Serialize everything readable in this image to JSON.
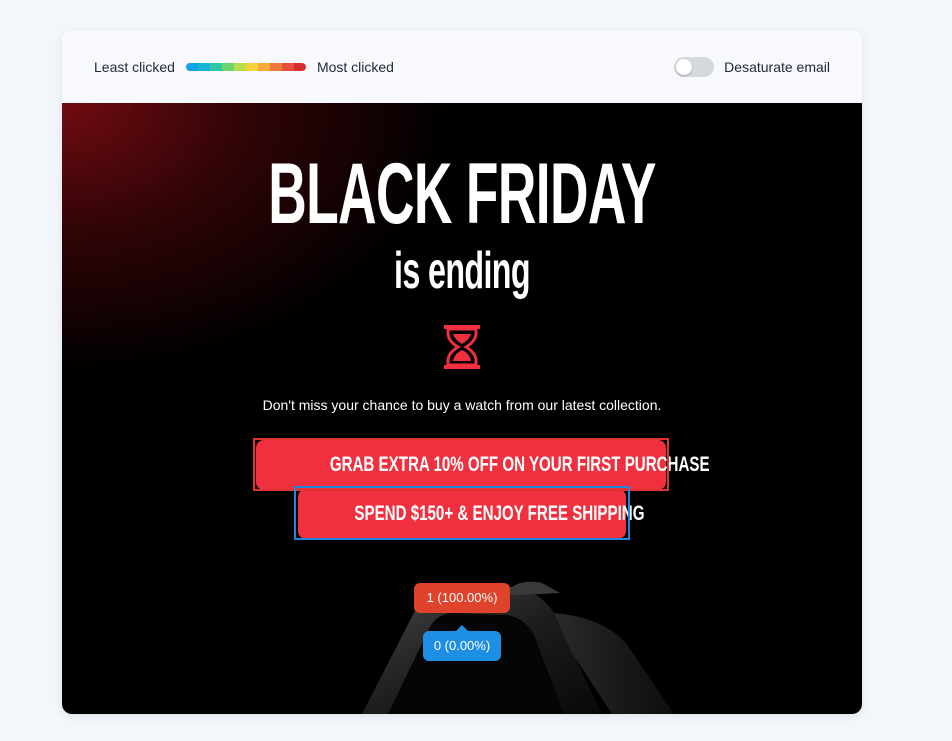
{
  "legend": {
    "least_label": "Least clicked",
    "most_label": "Most clicked",
    "gradient_colors": [
      "#0aa3e8",
      "#16b4d4",
      "#2ec7a8",
      "#6fd36b",
      "#b8dc4a",
      "#f6d23a",
      "#f6a93a",
      "#ee7a3a",
      "#e4503a",
      "#d62f2f"
    ]
  },
  "desaturate": {
    "label": "Desaturate email",
    "enabled": false
  },
  "email": {
    "headline": "BLACK FRIDAY",
    "subheadline": "is ending",
    "hourglass_icon": "hourglass-icon",
    "tagline": "Don't miss your chance to buy a watch from our latest collection.",
    "cta_primary": "GRAB EXTRA 10% OFF ON YOUR FIRST PURCHASE",
    "cta_secondary": "SPEND $150+ & ENJOY FREE SHIPPING",
    "accent_color": "#f0303f"
  },
  "click_stats": {
    "primary": {
      "label": "1 (100.00%)",
      "clicks": 1,
      "percent": 100.0,
      "color": "#e0432b"
    },
    "secondary": {
      "label": "0 (0.00%)",
      "clicks": 0,
      "percent": 0.0,
      "color": "#1e8fe3"
    }
  }
}
